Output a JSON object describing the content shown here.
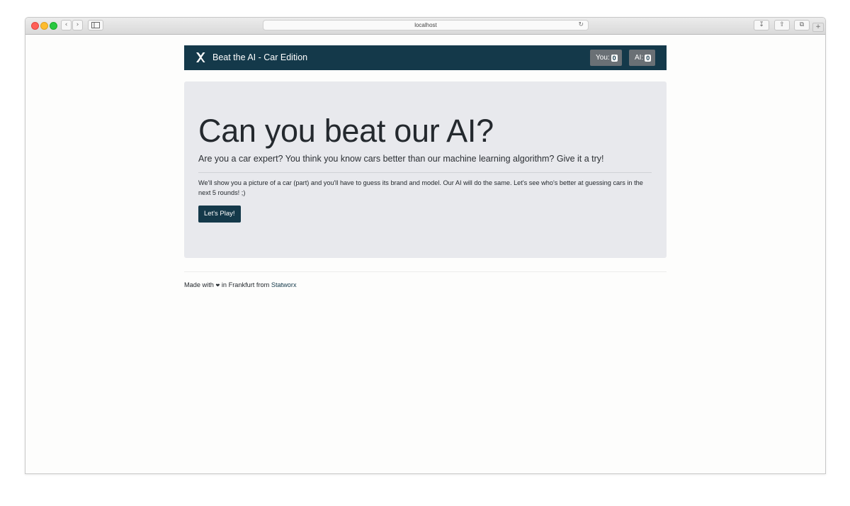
{
  "browser": {
    "url": "localhost"
  },
  "navbar": {
    "brand": "Beat the AI - Car Edition",
    "scores": {
      "you_label": "You:",
      "you_value": "0",
      "ai_label": "AI:",
      "ai_value": "0"
    }
  },
  "hero": {
    "title": "Can you beat our AI?",
    "lead": "Are you a car expert? You think you know cars better than our machine learning algorithm? Give it a try!",
    "description": "We'll show you a picture of a car (part) and you'll have to guess its brand and model. Our AI will do the same. Let's see who's better at guessing cars in the next 5 rounds! ;)",
    "button_label": "Let's Play!"
  },
  "footer": {
    "text_before": "Made with",
    "heart": "❤",
    "text_middle": "in Frankfurt from",
    "link": "Statworx"
  },
  "colors": {
    "brand_dark": "#14394a",
    "jumbotron_bg": "#e8e9ed",
    "score_button_bg": "#6a7075"
  }
}
